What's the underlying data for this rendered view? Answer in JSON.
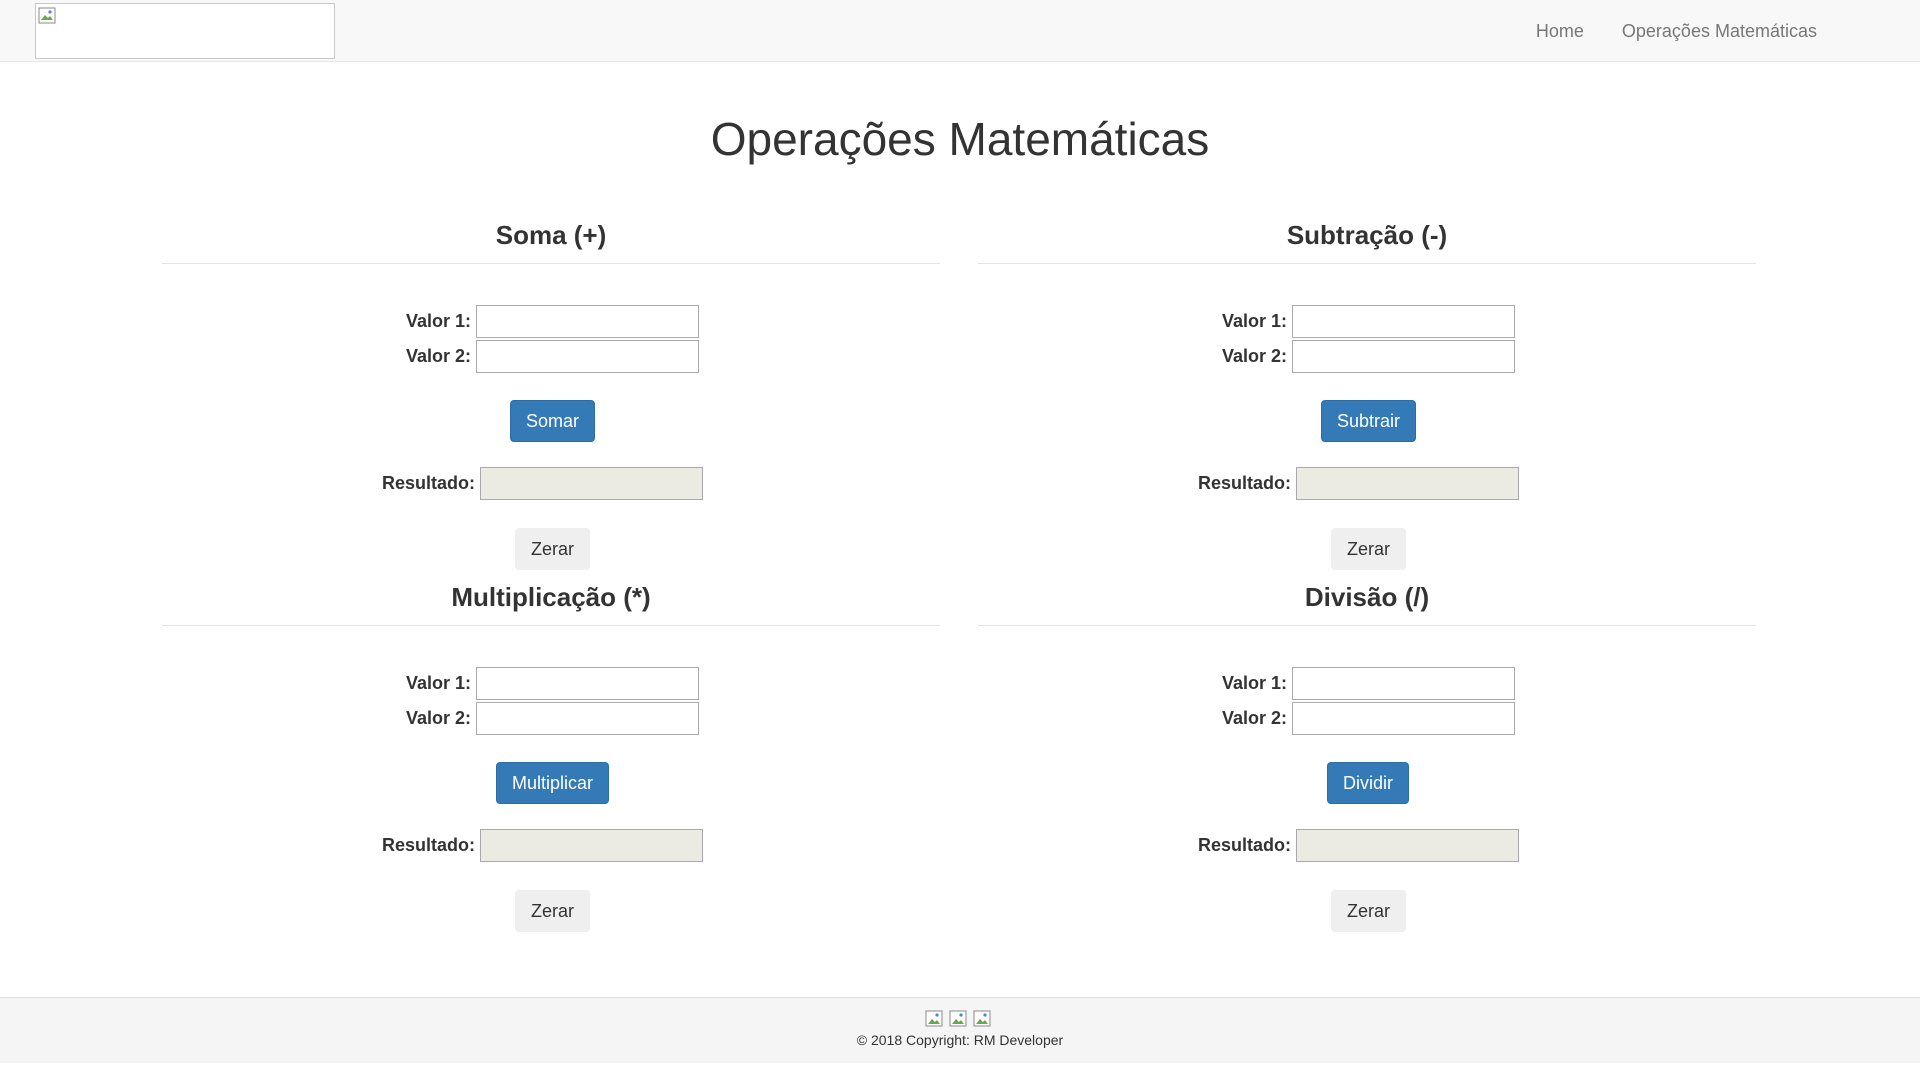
{
  "nav": {
    "links": [
      "Home",
      "Operações Matemáticas"
    ]
  },
  "page": {
    "title": "Operações Matemáticas"
  },
  "labels": {
    "value1": "Valor 1:",
    "value2": "Valor 2:",
    "result": "Resultado:",
    "reset": "Zerar"
  },
  "operations": [
    {
      "title": "Soma (+)",
      "action": "Somar",
      "value1": "",
      "value2": "",
      "result": ""
    },
    {
      "title": "Subtração (-)",
      "action": "Subtrair",
      "value1": "",
      "value2": "",
      "result": ""
    },
    {
      "title": "Multiplicação (*)",
      "action": "Multiplicar",
      "value1": "",
      "value2": "",
      "result": ""
    },
    {
      "title": "Divisão (/)",
      "action": "Dividir",
      "value1": "",
      "value2": "",
      "result": ""
    }
  ],
  "footer": {
    "copyright": "© 2018 Copyright: RM Developer",
    "social_icons": [
      "broken-image-icon",
      "broken-image-icon",
      "broken-image-icon"
    ]
  },
  "colors": {
    "primary": "#337ab7",
    "navbar_bg": "#f8f8f8",
    "footer_bg": "#f5f5f5",
    "readonly_bg": "#ebebe4"
  }
}
